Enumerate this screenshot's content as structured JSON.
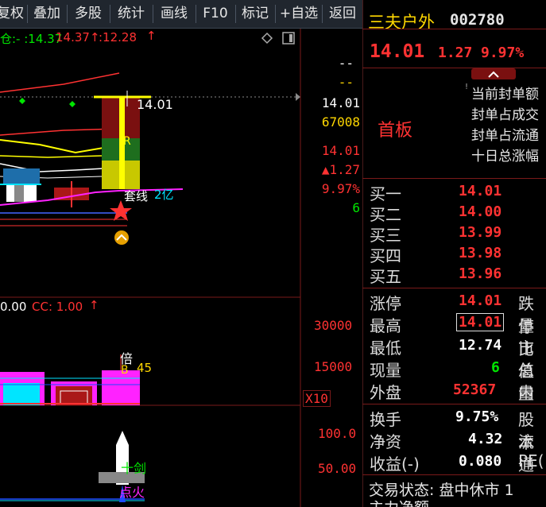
{
  "toolbar": {
    "items": [
      "复权",
      "叠加",
      "多股",
      "统计",
      "画线",
      "F10",
      "标记",
      "+自选",
      "返回"
    ]
  },
  "chart": {
    "header_text": "仓:-  :14.37",
    "header_text2": ":12.28",
    "price_marker": "14.01",
    "label_pos": "R",
    "label_amount": "2亿",
    "label_jiaxian": "套线",
    "right_axis": [
      "--",
      "--",
      "14.01",
      "67008",
      "14.01",
      "▲1.27",
      "9.97%",
      "6"
    ],
    "vol_header_left": "0.00",
    "vol_header_cc": "CC: 1.00",
    "vol_axis": [
      "30000",
      "15000",
      "X10"
    ],
    "vol_label_bei": "倍",
    "vol_label_45": "45",
    "vol_label_b": "B",
    "ind_axis": [
      "100.0",
      "50.00"
    ],
    "ind_label_jian": "十剑",
    "ind_label_fire": "点火"
  },
  "panel": {
    "stock_name": "三夫户外",
    "stock_code": "002780",
    "price": "14.01",
    "change": "1.27",
    "change_pct": "9.97%",
    "board_label": "首板",
    "info_lines": [
      "当前封单额",
      "封单占成交",
      "封单占流通",
      "十日总涨幅"
    ],
    "bids": [
      {
        "label": "买一",
        "value": "14.01"
      },
      {
        "label": "买二",
        "value": "14.00"
      },
      {
        "label": "买三",
        "value": "13.99"
      },
      {
        "label": "买四",
        "value": "13.98"
      },
      {
        "label": "买五",
        "value": "13.96"
      }
    ],
    "stats": [
      {
        "label": "涨停",
        "value": "14.01",
        "color": "red",
        "right": "跌停"
      },
      {
        "label": "最高",
        "value": "14.01",
        "color": "red",
        "right": "量比"
      },
      {
        "label": "最低",
        "value": "12.74",
        "color": "white",
        "right": "市值"
      },
      {
        "label": "现量",
        "value": "6",
        "color": "green",
        "right": "总量"
      },
      {
        "label": "外盘",
        "value": "52367",
        "color": "red",
        "right": "内盘"
      }
    ],
    "fin": [
      {
        "label": "换手",
        "value": "9.75%",
        "right": "股本"
      },
      {
        "label": "净资",
        "value": "4.32",
        "right": "流通"
      },
      {
        "label": "收益(-)",
        "value": "0.080",
        "right": "PE("
      }
    ],
    "trade_status": "交易状态: 盘中休市 1",
    "bottom_partial": "主力净额"
  },
  "colors": {
    "up": "#ff3232",
    "down": "#00e600",
    "accent": "#ffd700",
    "cyan": "#00e5ff",
    "magenta": "#ff22ff"
  }
}
